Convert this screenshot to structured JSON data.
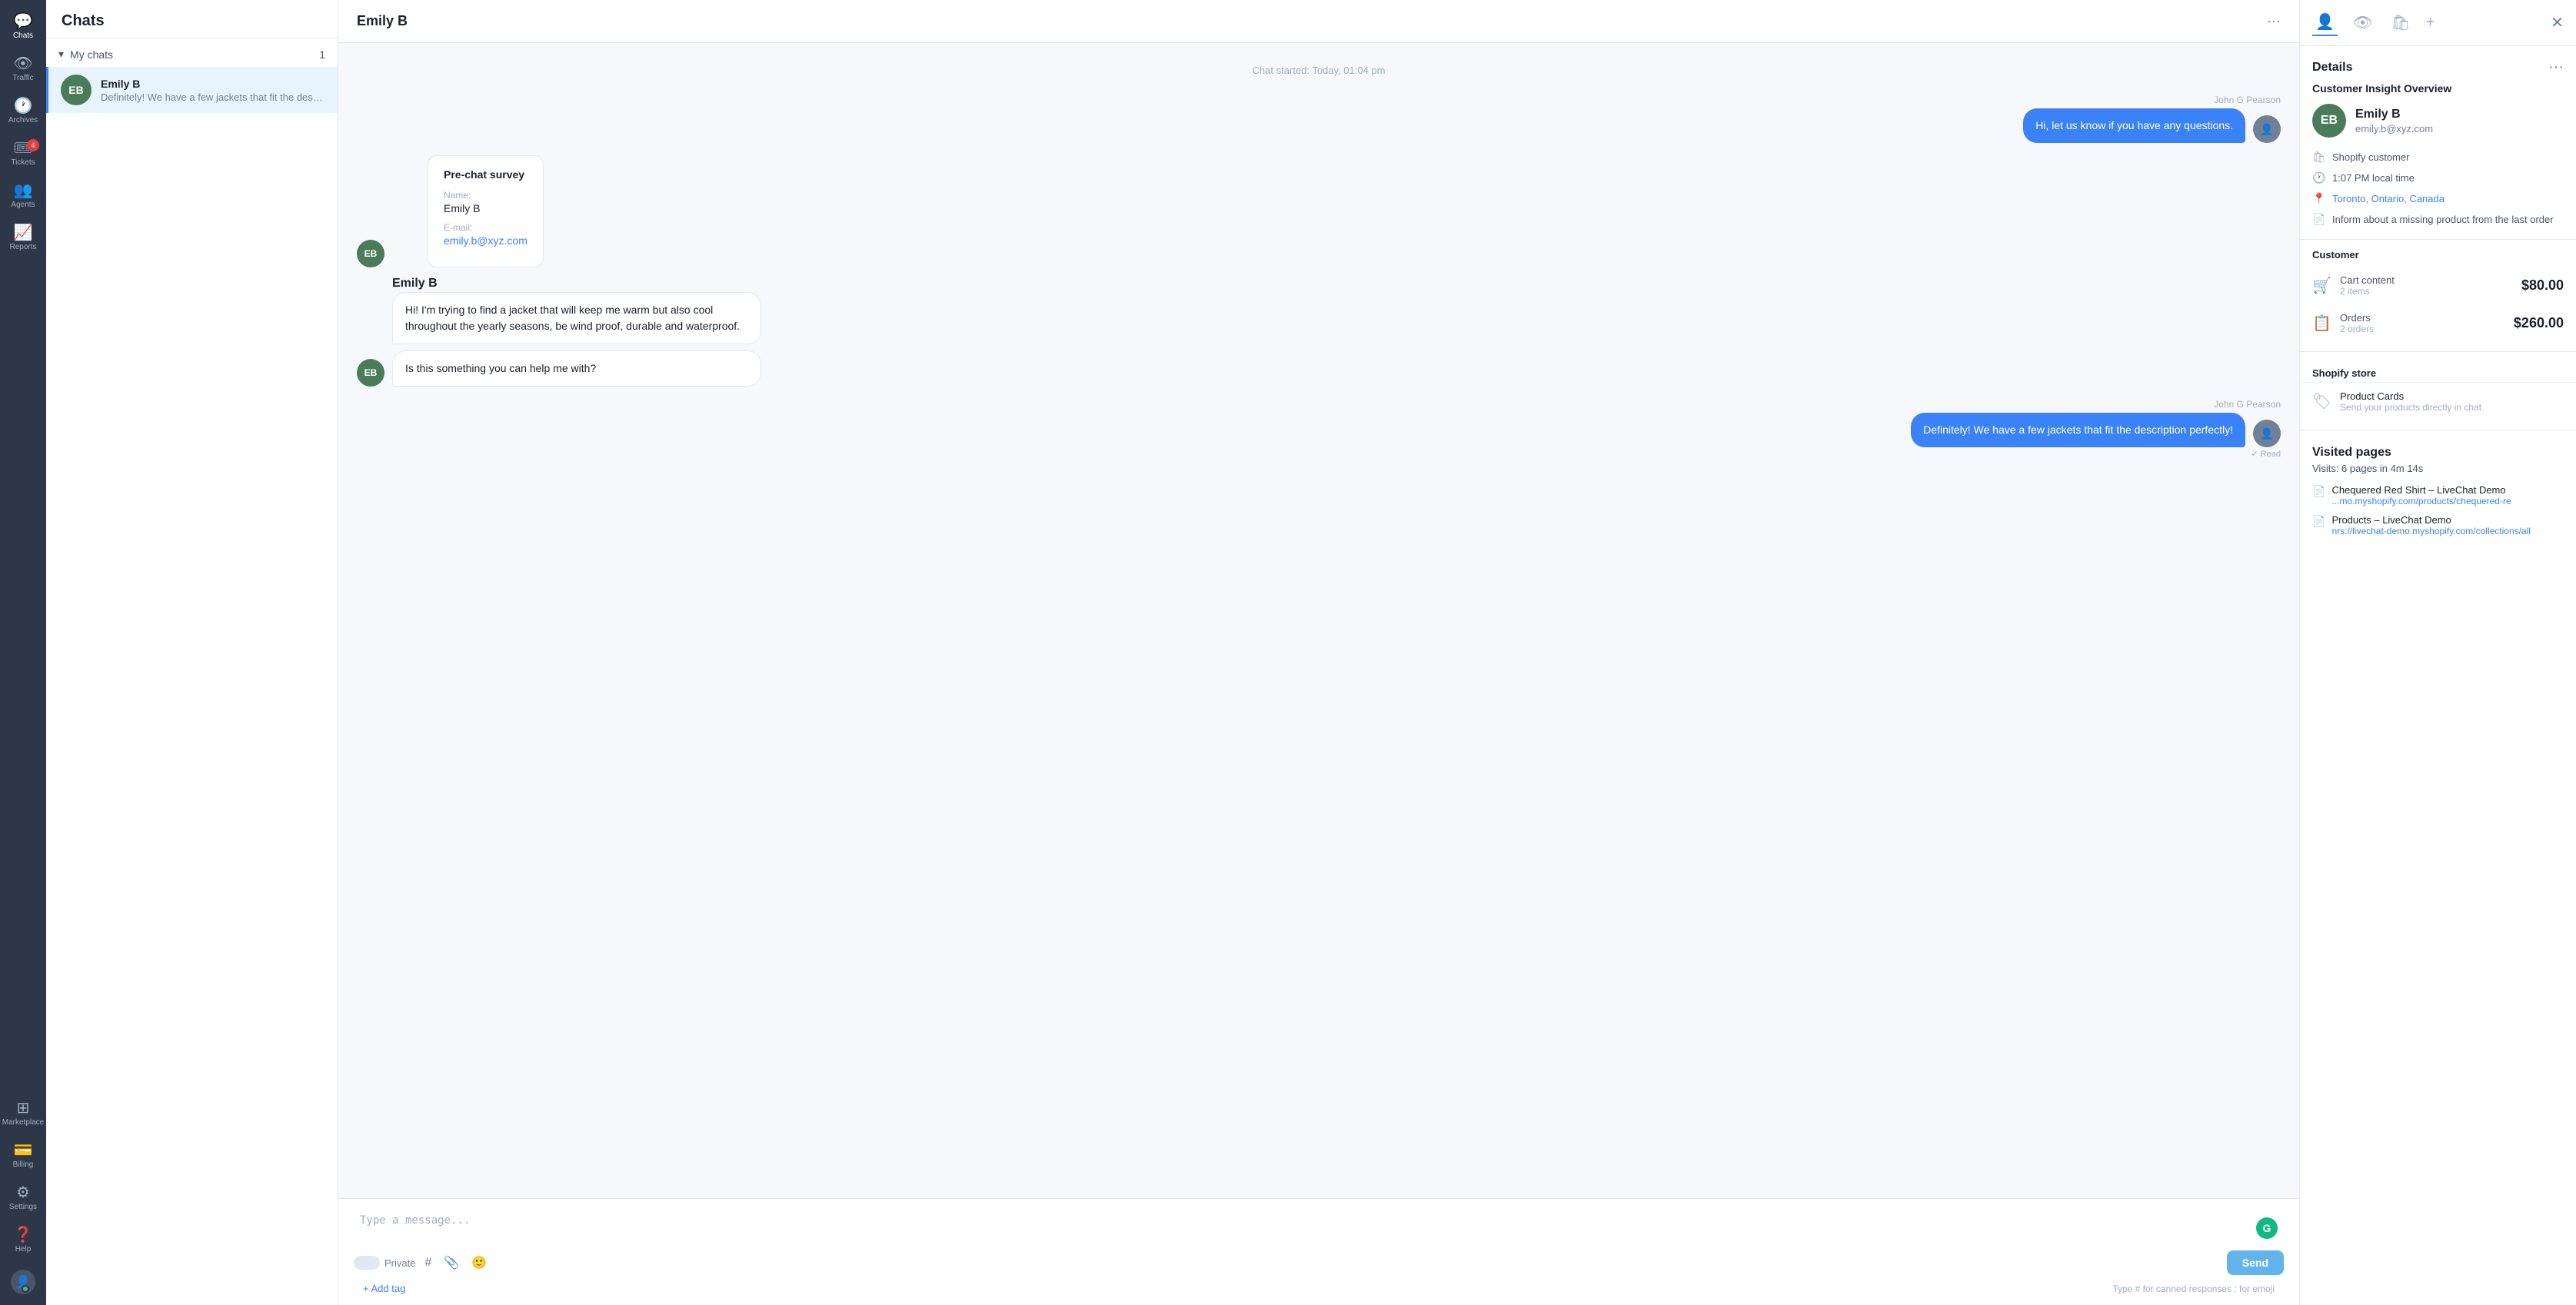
{
  "app": {
    "title": "Chats"
  },
  "left_nav": {
    "items": [
      {
        "id": "chats",
        "label": "Chats",
        "icon": "💬",
        "active": true,
        "badge": null
      },
      {
        "id": "traffic",
        "label": "Traffic",
        "icon": "👁",
        "active": false,
        "badge": null
      },
      {
        "id": "archives",
        "label": "Archives",
        "icon": "🕐",
        "active": false,
        "badge": null
      },
      {
        "id": "tickets",
        "label": "Tickets",
        "icon": "🎟",
        "active": false,
        "badge": "4"
      },
      {
        "id": "agents",
        "label": "Agents",
        "icon": "👥",
        "active": false,
        "badge": null
      },
      {
        "id": "reports",
        "label": "Reports",
        "icon": "📈",
        "active": false,
        "badge": null
      },
      {
        "id": "marketplace",
        "label": "Marketplace",
        "icon": "⊞",
        "active": false,
        "badge": null
      },
      {
        "id": "billing",
        "label": "Billing",
        "icon": "💳",
        "active": false,
        "badge": null
      },
      {
        "id": "settings",
        "label": "Settings",
        "icon": "⚙",
        "active": false,
        "badge": null
      },
      {
        "id": "help",
        "label": "Help",
        "icon": "❓",
        "active": false,
        "badge": null
      }
    ]
  },
  "chat_list": {
    "title": "Chats",
    "section_label": "My chats",
    "section_count": "1",
    "items": [
      {
        "id": "emily-b",
        "name": "Emily B",
        "initials": "EB",
        "preview": "Definitely! We have a few jackets that fit the desc...",
        "active": true
      }
    ]
  },
  "chat_main": {
    "contact_name": "Emily B",
    "more_icon": "···",
    "chat_started": "Chat started: Today, 01:04 pm",
    "messages": [
      {
        "id": "msg1",
        "type": "agent",
        "sender": "John G Pearson",
        "text": "Hi, let us know if you have any questions.",
        "has_avatar": true
      },
      {
        "id": "msg2",
        "type": "prechat",
        "form_title": "Pre-chat survey",
        "fields": [
          {
            "label": "Name:",
            "value": "Emily B",
            "is_email": false
          },
          {
            "label": "E-mail:",
            "value": "emily.b@xyz.com",
            "is_email": true
          }
        ]
      },
      {
        "id": "msg3",
        "type": "customer",
        "sender": "Emily B",
        "messages": [
          "Hi! I'm trying to find a jacket that will keep me warm but also cool throughout the yearly seasons, be wind proof, durable and waterproof.",
          "Is this something you can help me with?"
        ]
      },
      {
        "id": "msg4",
        "type": "agent",
        "sender": "John G Pearson",
        "text": "Definitely! We have a few jackets that fit the description perfectly!",
        "read_status": "✓ Read",
        "has_avatar": true
      }
    ],
    "input": {
      "placeholder": "Type a message...",
      "private_label": "Private",
      "send_label": "Send",
      "hint": "Type # for canned responses  :  for emoji",
      "add_tag": "+ Add tag"
    }
  },
  "right_panel": {
    "close_label": "✕",
    "section_title": "Details",
    "more_label": "···",
    "customer_insight_title": "Customer Insight Overview",
    "customer": {
      "name": "Emily B",
      "initials": "EB",
      "email": "emily.b@xyz.com",
      "type": "Shopify customer",
      "local_time": "1:07 PM local time",
      "location": "Toronto, Ontario, Canada",
      "note": "Inform about a missing product from the last order"
    },
    "section_customer": "Customer",
    "cart": {
      "title": "Cart content",
      "subtitle": "2 items",
      "value": "$80.00"
    },
    "orders": {
      "title": "Orders",
      "subtitle": "2 orders",
      "value": "$260.00"
    },
    "shopify_store_label": "Shopify store",
    "product_cards": {
      "title": "Product Cards",
      "subtitle": "Send your products directly in chat"
    },
    "visited_pages": {
      "title": "Visited pages",
      "summary": "Visits: 6 pages in 4m 14s",
      "pages": [
        {
          "title": "Chequered Red Shirt – LiveChat Demo",
          "url": "...mo.myshopify.com/products/chequered-re"
        },
        {
          "title": "Products – LiveChat Demo",
          "url": "nrs://livechat-demo.myshopify.com/collections/all"
        }
      ]
    }
  }
}
